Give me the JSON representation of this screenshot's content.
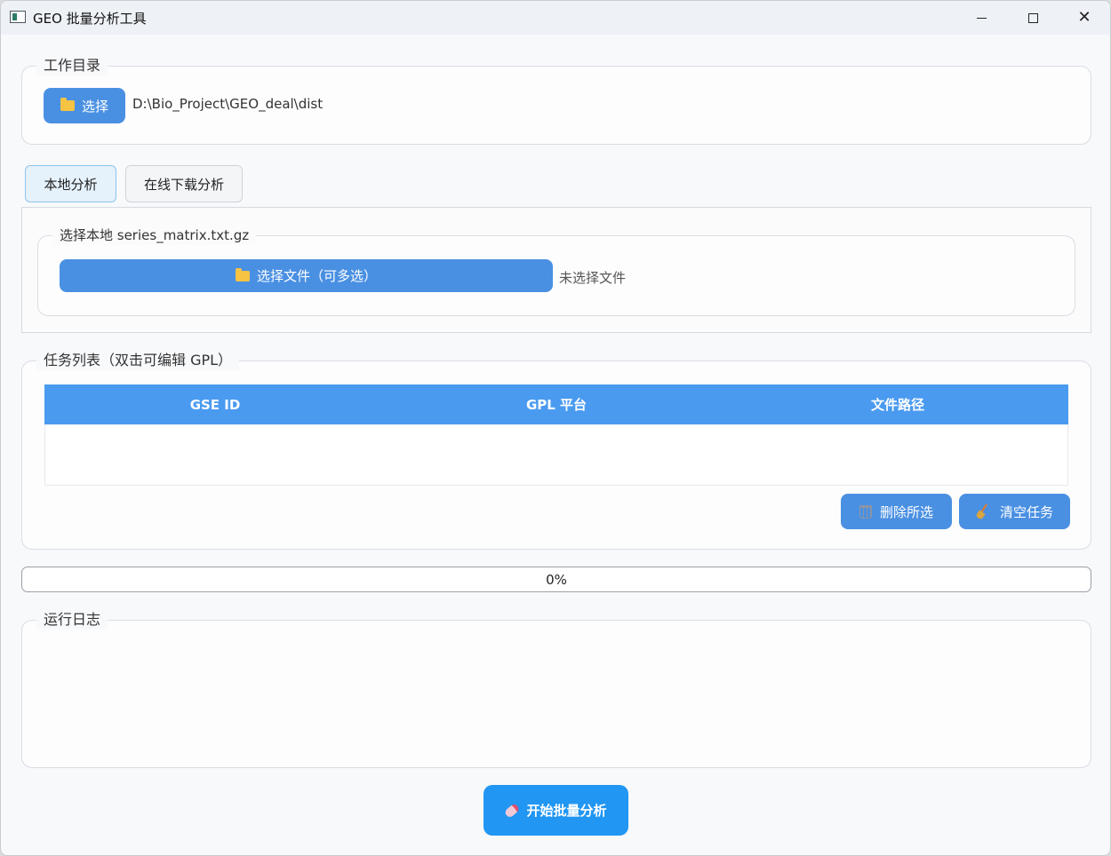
{
  "window": {
    "title": "GEO 批量分析工具"
  },
  "workdir": {
    "label": "工作目录",
    "button": "选择",
    "path": "D:\\Bio_Project\\GEO_deal\\dist"
  },
  "tabs": [
    {
      "label": "本地分析",
      "active": true
    },
    {
      "label": "在线下载分析",
      "active": false
    }
  ],
  "local": {
    "label": "选择本地   series_matrix.txt.gz",
    "button": "选择文件（可多选）",
    "status": "未选择文件"
  },
  "tasks": {
    "label": "任务列表（双击可编辑 GPL）",
    "columns": [
      "GSE ID",
      "GPL 平台",
      "文件路径"
    ],
    "rows": [],
    "delete_button": "删除所选",
    "clear_button": "清空任务"
  },
  "progress": {
    "value": 0,
    "text": "0%"
  },
  "log": {
    "label": "运行日志",
    "content": ""
  },
  "start_button": "开始批量分析",
  "colors": {
    "accent": "#4a90e2",
    "table_header": "#4a9af0",
    "start": "#2196f3"
  }
}
